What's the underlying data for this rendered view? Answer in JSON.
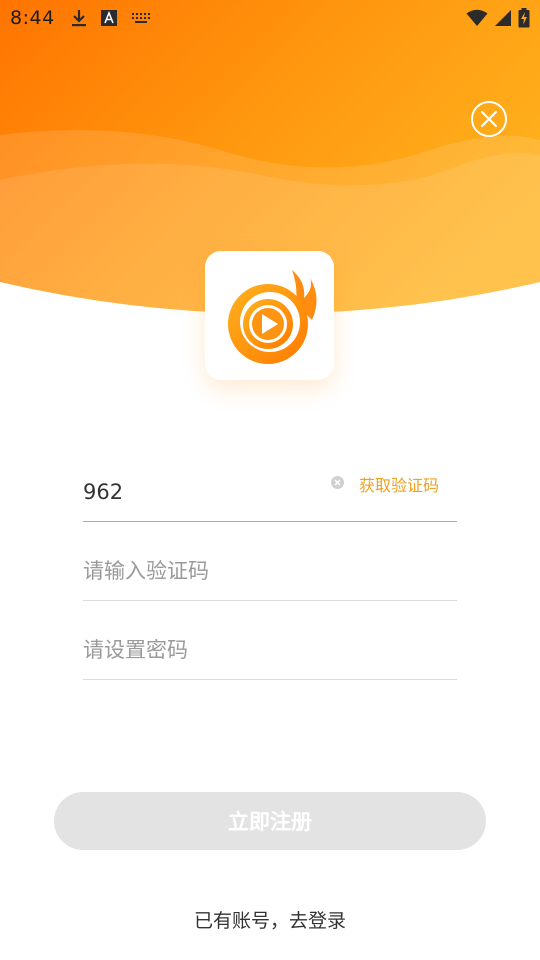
{
  "status_bar": {
    "time": "8:44",
    "left_icons": [
      "download-icon",
      "a-square-icon",
      "keyboard-icon"
    ],
    "right_icons": [
      "wifi-icon",
      "signal-icon",
      "battery-charging-icon"
    ]
  },
  "header": {
    "close_icon": "close-circle-icon",
    "logo_icon": "play-flame-logo-icon"
  },
  "form": {
    "phone": {
      "value": "962",
      "clear_icon": "clear-icon"
    },
    "get_code_label": "获取验证码",
    "code": {
      "value": "",
      "placeholder": "请输入验证码"
    },
    "password": {
      "value": "",
      "placeholder": "请设置密码"
    }
  },
  "register_label": "立即注册",
  "login_link_label": "已有账号，去登录",
  "colors": {
    "accent": "#f0a020",
    "header_start": "#ff7a00",
    "header_end": "#ffb020",
    "button_disabled": "#e3e3e3"
  }
}
